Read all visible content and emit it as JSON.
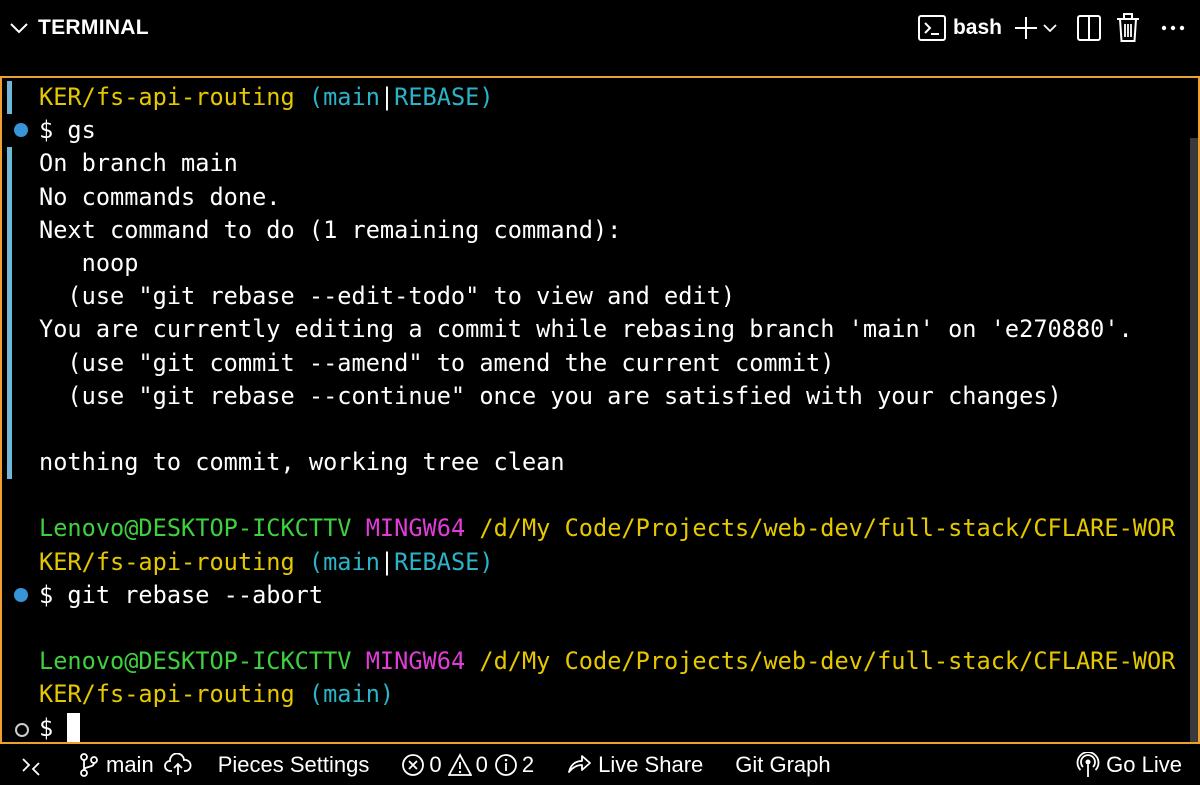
{
  "panel": {
    "title": "TERMINAL",
    "shell": "bash"
  },
  "icons": {
    "collapse": "chevron-down-icon",
    "terminal": "terminal-icon",
    "add": "plus-icon",
    "dropdown": "chevron-down-icon",
    "split": "split-editor-icon",
    "trash": "trash-icon",
    "more": "ellipsis-icon"
  },
  "colors": {
    "panel_border": "#f0a030",
    "command_marker": "#3794d6",
    "path_yellow": "#e5c800",
    "branch_cyan": "#2bb3c8",
    "user_green": "#3fd03f",
    "env_magenta": "#e03cd8"
  },
  "terminal": {
    "lines": [
      {
        "segments": [
          {
            "text": "KER/fs-api-routing",
            "color": "y"
          },
          {
            "text": " (main",
            "color": "c"
          },
          {
            "text": "|",
            "color": "w"
          },
          {
            "text": "REBASE)",
            "color": "c"
          }
        ]
      },
      {
        "marker": "filled",
        "segments": [
          {
            "text": "$ gs",
            "color": "w"
          }
        ]
      },
      {
        "segments": [
          {
            "text": "On branch main",
            "color": "w"
          }
        ]
      },
      {
        "segments": [
          {
            "text": "No commands done.",
            "color": "w"
          }
        ]
      },
      {
        "segments": [
          {
            "text": "Next command to do (1 remaining command):",
            "color": "w"
          }
        ]
      },
      {
        "segments": [
          {
            "text": "   noop",
            "color": "w"
          }
        ]
      },
      {
        "segments": [
          {
            "text": "  (use \"git rebase --edit-todo\" to view and edit)",
            "color": "w"
          }
        ]
      },
      {
        "segments": [
          {
            "text": "You are currently editing a commit while rebasing branch 'main' on 'e270880'.",
            "color": "w"
          }
        ]
      },
      {
        "segments": [
          {
            "text": "  (use \"git commit --amend\" to amend the current commit)",
            "color": "w"
          }
        ]
      },
      {
        "segments": [
          {
            "text": "  (use \"git rebase --continue\" once you are satisfied with your changes)",
            "color": "w"
          }
        ]
      },
      {
        "segments": [
          {
            "text": "",
            "color": "w"
          }
        ]
      },
      {
        "segments": [
          {
            "text": "nothing to commit, working tree clean",
            "color": "w"
          }
        ]
      },
      {
        "segments": [
          {
            "text": "",
            "color": "w"
          }
        ]
      },
      {
        "segments": [
          {
            "text": "Lenovo@DESKTOP-ICKCTTV",
            "color": "g"
          },
          {
            "text": " MINGW64",
            "color": "m"
          },
          {
            "text": " /d/My Code/Projects/web-dev/full-stack/CFLARE-WOR",
            "color": "y"
          }
        ]
      },
      {
        "segments": [
          {
            "text": "KER/fs-api-routing",
            "color": "y"
          },
          {
            "text": " (main",
            "color": "c"
          },
          {
            "text": "|",
            "color": "w"
          },
          {
            "text": "REBASE)",
            "color": "c"
          }
        ]
      },
      {
        "marker": "filled",
        "segments": [
          {
            "text": "$ git rebase --abort",
            "color": "w"
          }
        ]
      },
      {
        "segments": [
          {
            "text": "",
            "color": "w"
          }
        ]
      },
      {
        "segments": [
          {
            "text": "Lenovo@DESKTOP-ICKCTTV",
            "color": "g"
          },
          {
            "text": " MINGW64",
            "color": "m"
          },
          {
            "text": " /d/My Code/Projects/web-dev/full-stack/CFLARE-WOR",
            "color": "y"
          }
        ]
      },
      {
        "segments": [
          {
            "text": "KER/fs-api-routing",
            "color": "y"
          },
          {
            "text": " (main)",
            "color": "c"
          }
        ]
      },
      {
        "marker": "hollow",
        "cursor": true,
        "segments": [
          {
            "text": "$ ",
            "color": "w"
          }
        ]
      }
    ]
  },
  "statusbar": {
    "remote_icon": "remote-icon",
    "branch": "main",
    "branch_icon": "source-branch-icon",
    "sync_icon": "cloud-upload-icon",
    "pieces": "Pieces Settings",
    "errors": "0",
    "warnings": "0",
    "infos": "2",
    "live_share": "Live Share",
    "git_graph": "Git Graph",
    "go_live": "Go Live"
  }
}
